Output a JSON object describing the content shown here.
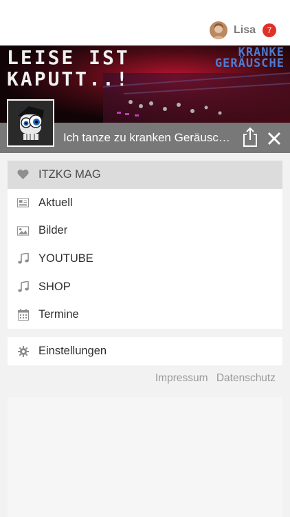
{
  "user": {
    "name": "Lisa",
    "notifications": "7"
  },
  "banner": {
    "title_line1": "LEISE IST",
    "title_line2": "KAPUTT..!",
    "logo_line1": "KRANKE",
    "logo_line2": "GERÄUSCHE"
  },
  "channel": {
    "title": "Ich tanze zu kranken Geräuschen"
  },
  "menu": {
    "items": [
      {
        "label": "ITZKG MAG",
        "icon": "heart-icon",
        "active": true
      },
      {
        "label": "Aktuell",
        "icon": "newspaper-icon"
      },
      {
        "label": "Bilder",
        "icon": "image-icon"
      },
      {
        "label": "YOUTUBE",
        "icon": "music-note-icon"
      },
      {
        "label": "SHOP",
        "icon": "music-note-icon"
      },
      {
        "label": "Termine",
        "icon": "calendar-icon"
      }
    ]
  },
  "settings": {
    "label": "Einstellungen",
    "icon": "gear-icon"
  },
  "footer": {
    "impressum": "Impressum",
    "datenschutz": "Datenschutz"
  },
  "colors": {
    "badge": "#e0302a",
    "titlebar": "#787878",
    "active_item": "#dcdcdc",
    "icon": "#8e8e8e"
  }
}
